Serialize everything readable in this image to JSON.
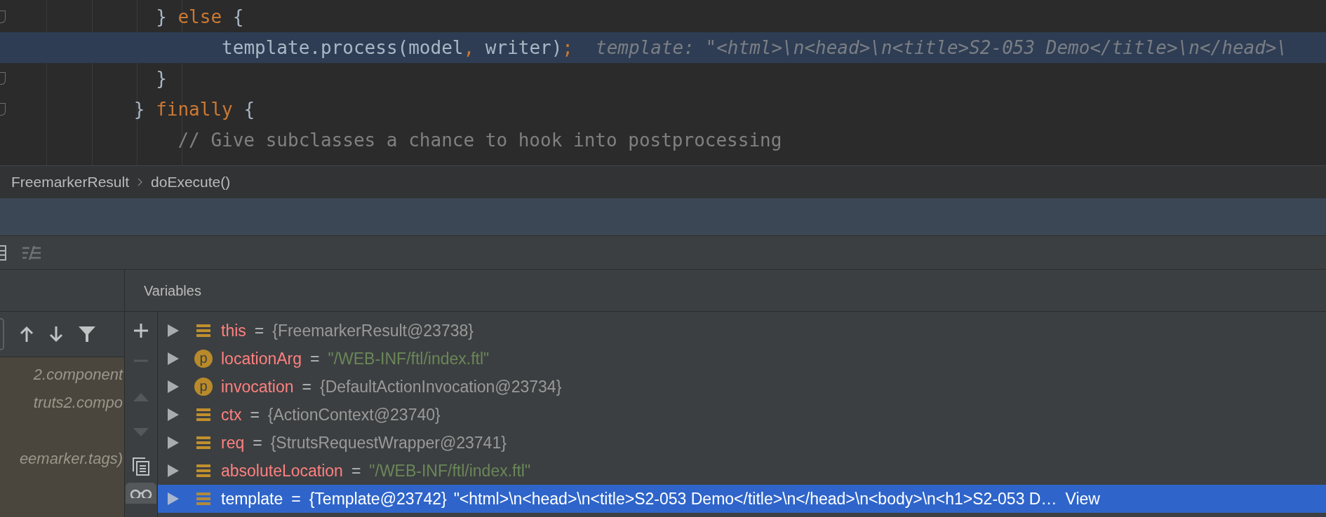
{
  "editor": {
    "lines": [
      {
        "fold": true,
        "current": false,
        "tokens": [
          {
            "text": "              } ",
            "kind": "punct"
          },
          {
            "text": "else",
            "kind": "keyword"
          },
          {
            "text": " {",
            "kind": "punct"
          }
        ]
      },
      {
        "fold": false,
        "current": true,
        "tokens": [
          {
            "text": "                    template.process(model",
            "kind": "punct"
          },
          {
            "text": ",",
            "kind": "keyword"
          },
          {
            "text": " writer)",
            "kind": "punct"
          },
          {
            "text": ";",
            "kind": "keyword"
          }
        ],
        "hint": "template: \"<html>\\n<head>\\n<title>S2-053 Demo</title>\\n</head>\\"
      },
      {
        "fold": true,
        "current": false,
        "tokens": [
          {
            "text": "              }",
            "kind": "punct"
          }
        ]
      },
      {
        "fold": true,
        "current": false,
        "tokens": [
          {
            "text": "            } ",
            "kind": "punct"
          },
          {
            "text": "finally",
            "kind": "keyword"
          },
          {
            "text": " {",
            "kind": "punct"
          }
        ]
      },
      {
        "fold": false,
        "current": false,
        "tokens": [
          {
            "text": "                // Give subclasses a chance to hook into postprocessing",
            "kind": "comment"
          }
        ]
      }
    ]
  },
  "breadcrumb": [
    "FreemarkerResult",
    "doExecute()"
  ],
  "frames": {
    "items": [
      "2.component",
      "truts2.compo",
      "eemarker.tags)"
    ]
  },
  "variables": {
    "title": "Variables",
    "rows": [
      {
        "kind": "field",
        "name": "this",
        "sep": "=",
        "value": [
          {
            "text": "{FreemarkerResult@23738}",
            "kind": "object"
          }
        ],
        "selected": false
      },
      {
        "kind": "param",
        "badge": "p",
        "name": "locationArg",
        "sep": "=",
        "value": [
          {
            "text": "\"/WEB-INF/ftl/index.ftl\"",
            "kind": "string"
          }
        ],
        "selected": false
      },
      {
        "kind": "param",
        "badge": "p",
        "name": "invocation",
        "sep": "=",
        "value": [
          {
            "text": "{DefaultActionInvocation@23734}",
            "kind": "object"
          }
        ],
        "selected": false
      },
      {
        "kind": "field",
        "name": "ctx",
        "sep": "=",
        "value": [
          {
            "text": "{ActionContext@23740}",
            "kind": "object"
          }
        ],
        "selected": false
      },
      {
        "kind": "field",
        "name": "req",
        "sep": "=",
        "value": [
          {
            "text": "{StrutsRequestWrapper@23741}",
            "kind": "object"
          }
        ],
        "selected": false
      },
      {
        "kind": "field",
        "name": "absoluteLocation",
        "sep": "=",
        "value": [
          {
            "text": "\"/WEB-INF/ftl/index.ftl\"",
            "kind": "string"
          }
        ],
        "selected": false
      },
      {
        "kind": "field",
        "name": "template",
        "sep": "=",
        "value": [
          {
            "text": "{Template@23742}",
            "kind": "object"
          }
        ],
        "selected": true,
        "extra": "\"<html>\\n<head>\\n<title>S2-053 Demo</title>\\n</head>\\n<body>\\n<h1>S2-053 D…",
        "link": "View"
      }
    ]
  }
}
